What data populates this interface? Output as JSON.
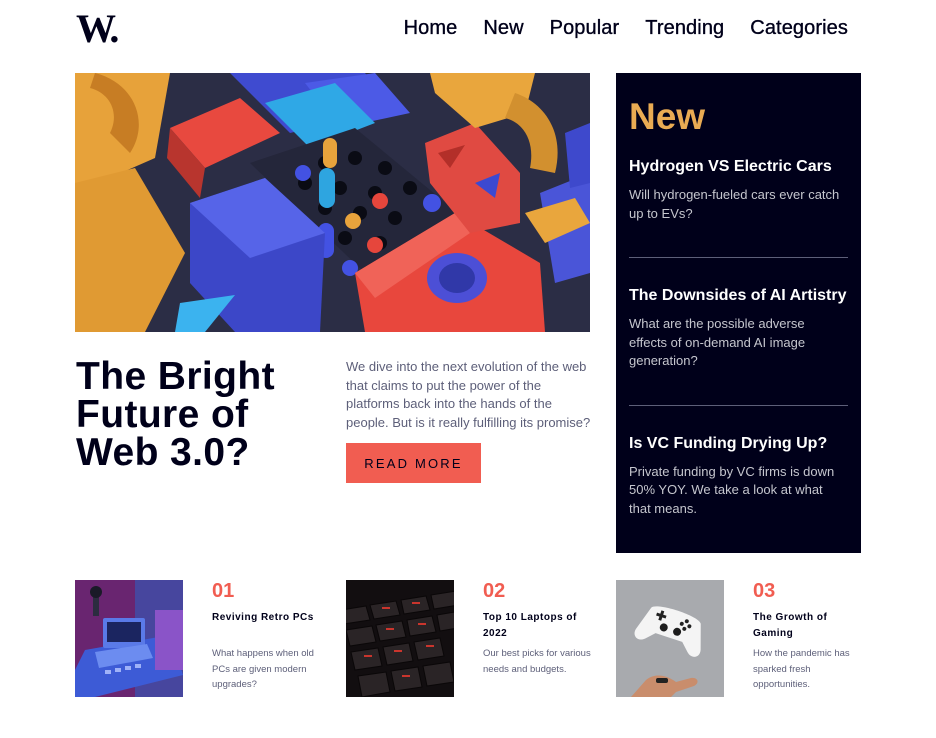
{
  "header": {
    "logo_text": "W.",
    "nav": [
      "Home",
      "New",
      "Popular",
      "Trending",
      "Categories"
    ]
  },
  "hero": {
    "title": "The Bright Future of Web 3.0?",
    "description": "We dive into the next evolution of the web that claims to put the power of the platforms back into the hands of the people. But is it really fulfilling its promise?",
    "button_label": "READ MORE"
  },
  "new_panel": {
    "heading": "New",
    "items": [
      {
        "title": "Hydrogen VS Electric Cars",
        "desc": "Will hydrogen-fueled cars ever catch up to EVs?"
      },
      {
        "title": "The Downsides of AI Artistry",
        "desc": "What are the possible adverse effects of on-demand AI image generation?"
      },
      {
        "title": "Is VC Funding Drying Up?",
        "desc": "Private funding by VC firms is down 50% YOY. We take a look at what that means."
      }
    ]
  },
  "cards": [
    {
      "num": "01",
      "title": "Reviving Retro PCs",
      "desc": "What happens when old PCs are given modern upgrades?"
    },
    {
      "num": "02",
      "title": "Top 10 Laptops of 2022",
      "desc": "Our best picks for various needs and budgets."
    },
    {
      "num": "03",
      "title": "The Growth of Gaming",
      "desc": "How the pandemic has sparked fresh opportunities."
    }
  ],
  "colors": {
    "accent_red": "#f15d51",
    "accent_orange": "#e9ab53",
    "dark_navy": "#00001a",
    "grayish_blue": "#5d5f79"
  }
}
